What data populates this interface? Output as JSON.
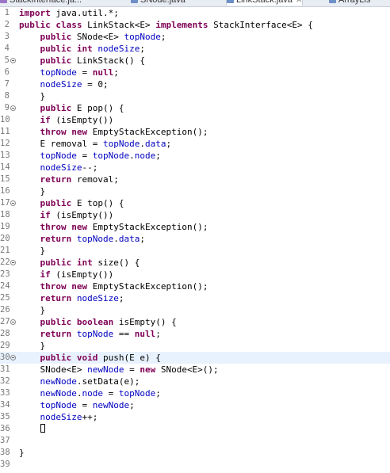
{
  "tabs": [
    {
      "label": "StackInterface.ja...",
      "icon": "interface-file-icon",
      "active": false
    },
    {
      "label": "SNode.java",
      "icon": "java-file-icon",
      "active": false
    },
    {
      "label": "LinkStack.java",
      "icon": "java-file-icon",
      "active": true,
      "close": "✕"
    },
    {
      "label": "ArrayLis",
      "icon": "java-file-icon",
      "active": false
    }
  ],
  "editor": {
    "current_line": 30,
    "fold_lines": [
      5,
      9,
      17,
      22,
      27,
      30
    ],
    "lines": [
      [
        [
          "kw",
          "import"
        ],
        [
          "t",
          " java.util.*;"
        ]
      ],
      [
        [
          "kw",
          "public"
        ],
        [
          "t",
          " "
        ],
        [
          "kw",
          "class"
        ],
        [
          "t",
          " LinkStack<E> "
        ],
        [
          "kw",
          "implements"
        ],
        [
          "t",
          " StackInterface<E> {"
        ]
      ],
      [
        [
          "t",
          "    "
        ],
        [
          "kw",
          "public"
        ],
        [
          "t",
          " SNode<E> "
        ],
        [
          "f",
          "topNode"
        ],
        [
          "t",
          ";"
        ]
      ],
      [
        [
          "t",
          "    "
        ],
        [
          "kw",
          "public"
        ],
        [
          "t",
          " "
        ],
        [
          "kw",
          "int"
        ],
        [
          "t",
          " "
        ],
        [
          "f",
          "nodeSize"
        ],
        [
          "t",
          ";"
        ]
      ],
      [
        [
          "t",
          "    "
        ],
        [
          "kw",
          "public"
        ],
        [
          "t",
          " LinkStack() {"
        ]
      ],
      [
        [
          "t",
          "    "
        ],
        [
          "f",
          "topNode"
        ],
        [
          "t",
          " = "
        ],
        [
          "kw",
          "null"
        ],
        [
          "t",
          ";"
        ]
      ],
      [
        [
          "t",
          "    "
        ],
        [
          "f",
          "nodeSize"
        ],
        [
          "t",
          " = 0;"
        ]
      ],
      [
        [
          "t",
          "    }"
        ]
      ],
      [
        [
          "t",
          "    "
        ],
        [
          "kw",
          "public"
        ],
        [
          "t",
          " E pop() {"
        ]
      ],
      [
        [
          "t",
          "    "
        ],
        [
          "kw",
          "if"
        ],
        [
          "t",
          " (isEmpty())"
        ]
      ],
      [
        [
          "t",
          "    "
        ],
        [
          "kw",
          "throw"
        ],
        [
          "t",
          " "
        ],
        [
          "kw",
          "new"
        ],
        [
          "t",
          " EmptyStackException();"
        ]
      ],
      [
        [
          "t",
          "    E removal = "
        ],
        [
          "f",
          "topNode"
        ],
        [
          "t",
          "."
        ],
        [
          "f",
          "data"
        ],
        [
          "t",
          ";"
        ]
      ],
      [
        [
          "t",
          "    "
        ],
        [
          "f",
          "topNode"
        ],
        [
          "t",
          " = "
        ],
        [
          "f",
          "topNode"
        ],
        [
          "t",
          "."
        ],
        [
          "f",
          "node"
        ],
        [
          "t",
          ";"
        ]
      ],
      [
        [
          "t",
          "    "
        ],
        [
          "f",
          "nodeSize"
        ],
        [
          "t",
          "--;"
        ]
      ],
      [
        [
          "t",
          "    "
        ],
        [
          "kw",
          "return"
        ],
        [
          "t",
          " removal;"
        ]
      ],
      [
        [
          "t",
          "    }"
        ]
      ],
      [
        [
          "t",
          "    "
        ],
        [
          "kw",
          "public"
        ],
        [
          "t",
          " E top() {"
        ]
      ],
      [
        [
          "t",
          "    "
        ],
        [
          "kw",
          "if"
        ],
        [
          "t",
          " (isEmpty())"
        ]
      ],
      [
        [
          "t",
          "    "
        ],
        [
          "kw",
          "throw"
        ],
        [
          "t",
          " "
        ],
        [
          "kw",
          "new"
        ],
        [
          "t",
          " EmptyStackException();"
        ]
      ],
      [
        [
          "t",
          "    "
        ],
        [
          "kw",
          "return"
        ],
        [
          "t",
          " "
        ],
        [
          "f",
          "topNode"
        ],
        [
          "t",
          "."
        ],
        [
          "f",
          "data"
        ],
        [
          "t",
          ";"
        ]
      ],
      [
        [
          "t",
          "    }"
        ]
      ],
      [
        [
          "t",
          "    "
        ],
        [
          "kw",
          "public"
        ],
        [
          "t",
          " "
        ],
        [
          "kw",
          "int"
        ],
        [
          "t",
          " size() {"
        ]
      ],
      [
        [
          "t",
          "    "
        ],
        [
          "kw",
          "if"
        ],
        [
          "t",
          " (isEmpty())"
        ]
      ],
      [
        [
          "t",
          "    "
        ],
        [
          "kw",
          "throw"
        ],
        [
          "t",
          " "
        ],
        [
          "kw",
          "new"
        ],
        [
          "t",
          " EmptyStackException();"
        ]
      ],
      [
        [
          "t",
          "    "
        ],
        [
          "kw",
          "return"
        ],
        [
          "t",
          " "
        ],
        [
          "f",
          "nodeSize"
        ],
        [
          "t",
          ";"
        ]
      ],
      [
        [
          "t",
          "    }"
        ]
      ],
      [
        [
          "t",
          "    "
        ],
        [
          "kw",
          "public"
        ],
        [
          "t",
          " "
        ],
        [
          "kw",
          "boolean"
        ],
        [
          "t",
          " isEmpty() {"
        ]
      ],
      [
        [
          "t",
          "    "
        ],
        [
          "kw",
          "return"
        ],
        [
          "t",
          " "
        ],
        [
          "f",
          "topNode"
        ],
        [
          "t",
          " == "
        ],
        [
          "kw",
          "null"
        ],
        [
          "t",
          ";"
        ]
      ],
      [
        [
          "t",
          "    }"
        ]
      ],
      [
        [
          "t",
          "    "
        ],
        [
          "kw",
          "public"
        ],
        [
          "t",
          " "
        ],
        [
          "kw",
          "void"
        ],
        [
          "t",
          " push(E e) {"
        ]
      ],
      [
        [
          "t",
          "    SNode<E> "
        ],
        [
          "f",
          "newNode"
        ],
        [
          "t",
          " = "
        ],
        [
          "kw",
          "new"
        ],
        [
          "t",
          " SNode<E>();"
        ]
      ],
      [
        [
          "t",
          "    "
        ],
        [
          "f",
          "newNode"
        ],
        [
          "t",
          ".setData(e);"
        ]
      ],
      [
        [
          "t",
          "    "
        ],
        [
          "f",
          "newNode"
        ],
        [
          "t",
          "."
        ],
        [
          "f",
          "node"
        ],
        [
          "t",
          " = "
        ],
        [
          "f",
          "topNode"
        ],
        [
          "t",
          ";"
        ]
      ],
      [
        [
          "t",
          "    "
        ],
        [
          "f",
          "topNode"
        ],
        [
          "t",
          " = "
        ],
        [
          "f",
          "newNode"
        ],
        [
          "t",
          ";"
        ]
      ],
      [
        [
          "t",
          "    "
        ],
        [
          "f",
          "nodeSize"
        ],
        [
          "t",
          "++;"
        ]
      ],
      [
        [
          "t",
          "    "
        ],
        [
          "c",
          ""
        ]
      ],
      [
        [
          "t",
          ""
        ]
      ],
      [
        [
          "t",
          "}"
        ]
      ],
      [
        [
          "t",
          ""
        ]
      ]
    ]
  }
}
